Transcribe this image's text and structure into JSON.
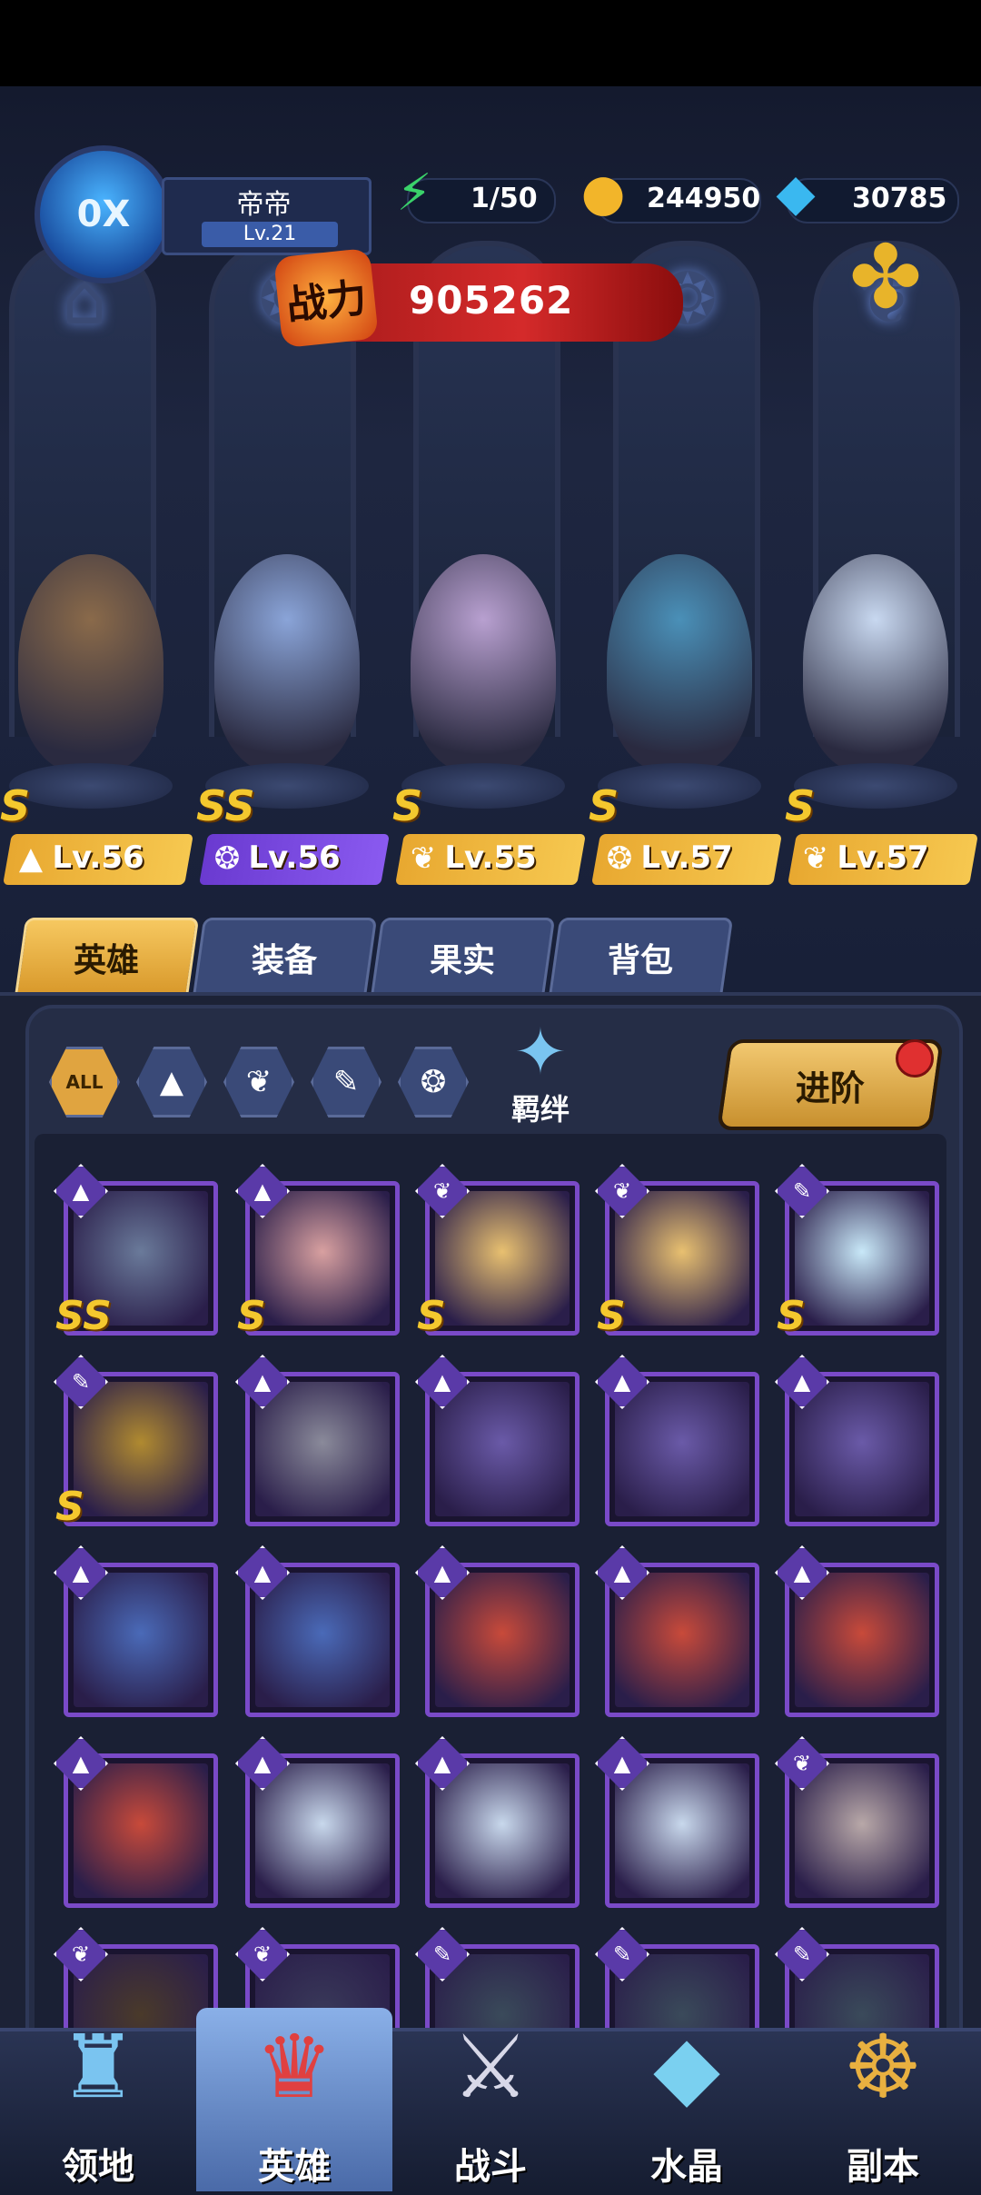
{
  "player": {
    "name": "帝帝",
    "level": "Lv.21",
    "avatar_text": "0X"
  },
  "resources": {
    "energy": "1/50",
    "gold": "244950",
    "gems": "30785"
  },
  "power": {
    "label": "战力",
    "value": "905262"
  },
  "lineup": [
    {
      "rank": "S",
      "level": "Lv.56",
      "class_icon": "mage-hat-icon",
      "bar": "gold",
      "color": "#8a6a4a"
    },
    {
      "rank": "SS",
      "level": "Lv.56",
      "class_icon": "beast-claw-icon",
      "bar": "purple",
      "color": "#8aa4d8"
    },
    {
      "rank": "S",
      "level": "Lv.55",
      "class_icon": "wing-icon",
      "bar": "gold",
      "color": "#b8a0d0"
    },
    {
      "rank": "S",
      "level": "Lv.57",
      "class_icon": "beast-claw-icon",
      "bar": "gold",
      "color": "#4a90b8"
    },
    {
      "rank": "S",
      "level": "Lv.57",
      "class_icon": "wing-icon",
      "bar": "gold",
      "color": "#c8d8f0"
    }
  ],
  "tabs": [
    "英雄",
    "装备",
    "果实",
    "背包"
  ],
  "filters": {
    "all_label": "ALL",
    "icons": [
      "mage-hat-icon",
      "wing-icon",
      "wrench-icon",
      "beast-claw-icon"
    ]
  },
  "bond_label": "羁绊",
  "advance_label": "进阶",
  "hero_cards": [
    {
      "cls": "mage-hat-icon",
      "rank": "SS",
      "color": "#6a7a9a"
    },
    {
      "cls": "mage-hat-icon",
      "rank": "S",
      "color": "#d8a0a0"
    },
    {
      "cls": "wing-icon",
      "rank": "S",
      "color": "#e8c070"
    },
    {
      "cls": "wing-icon",
      "rank": "S",
      "color": "#e8c070"
    },
    {
      "cls": "wrench-icon",
      "rank": "S",
      "color": "#c8e8f8"
    },
    {
      "cls": "wrench-icon",
      "rank": "S",
      "color": "#b08a30"
    },
    {
      "cls": "mage-hat-icon",
      "rank": "",
      "color": "#8a8a9a"
    },
    {
      "cls": "mage-hat-icon",
      "rank": "",
      "color": "#6a5aa8"
    },
    {
      "cls": "mage-hat-icon",
      "rank": "",
      "color": "#6a5aa8"
    },
    {
      "cls": "mage-hat-icon",
      "rank": "",
      "color": "#6a5aa8"
    },
    {
      "cls": "mage-hat-icon",
      "rank": "",
      "color": "#4a6ab8"
    },
    {
      "cls": "mage-hat-icon",
      "rank": "",
      "color": "#4a6ab8"
    },
    {
      "cls": "mage-hat-icon",
      "rank": "",
      "color": "#c84a3a"
    },
    {
      "cls": "mage-hat-icon",
      "rank": "",
      "color": "#c84a3a"
    },
    {
      "cls": "mage-hat-icon",
      "rank": "",
      "color": "#c84a3a"
    },
    {
      "cls": "mage-hat-icon",
      "rank": "",
      "color": "#c84a3a"
    },
    {
      "cls": "mage-hat-icon",
      "rank": "",
      "color": "#c8d8ec"
    },
    {
      "cls": "mage-hat-icon",
      "rank": "",
      "color": "#c8d8ec"
    },
    {
      "cls": "mage-hat-icon",
      "rank": "",
      "color": "#c8d8ec"
    },
    {
      "cls": "wing-icon",
      "rank": "",
      "color": "#b8a8a8"
    },
    {
      "cls": "wing-icon",
      "rank": "",
      "color": "#4a3a2a"
    },
    {
      "cls": "wing-icon",
      "rank": "",
      "color": "#3a3a5a"
    },
    {
      "cls": "wrench-icon",
      "rank": "",
      "color": "#3a4a5a"
    },
    {
      "cls": "wrench-icon",
      "rank": "",
      "color": "#3a4a5a"
    },
    {
      "cls": "wrench-icon",
      "rank": "",
      "color": "#3a4a5a"
    }
  ],
  "nav": [
    {
      "label": "领地",
      "icon": "castle-icon"
    },
    {
      "label": "英雄",
      "icon": "hero-hat-icon"
    },
    {
      "label": "战斗",
      "icon": "swords-icon"
    },
    {
      "label": "水晶",
      "icon": "crystal-icon"
    },
    {
      "label": "副本",
      "icon": "lantern-icon"
    }
  ],
  "colors": {
    "gold": "#f2b52a",
    "purple": "#7a4ac8",
    "accent_red": "#d42a2a"
  }
}
